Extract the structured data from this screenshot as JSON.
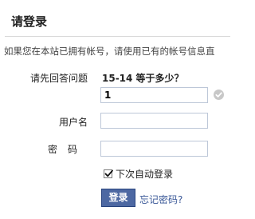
{
  "header": {
    "title": "请登录"
  },
  "intro_text": "如果您在本站已拥有帐号，请使用已有的帐号信息直",
  "form": {
    "question_label": "请先回答问题",
    "question_text": "15-14 等于多少？",
    "answer_value": "1",
    "answer_status_icon": "check-circle-icon",
    "username_label": "用户名",
    "username_value": "",
    "password_label": "密码",
    "password_value": "",
    "remember_label": "下次自动登录",
    "remember_checked": true
  },
  "actions": {
    "login_label": "登录",
    "forgot_label": "忘记密码?"
  },
  "colors": {
    "button_bg": "#4d68a2",
    "link": "#3b5998",
    "input_border": "#bdc7d8",
    "divider": "#d7d7d7"
  }
}
